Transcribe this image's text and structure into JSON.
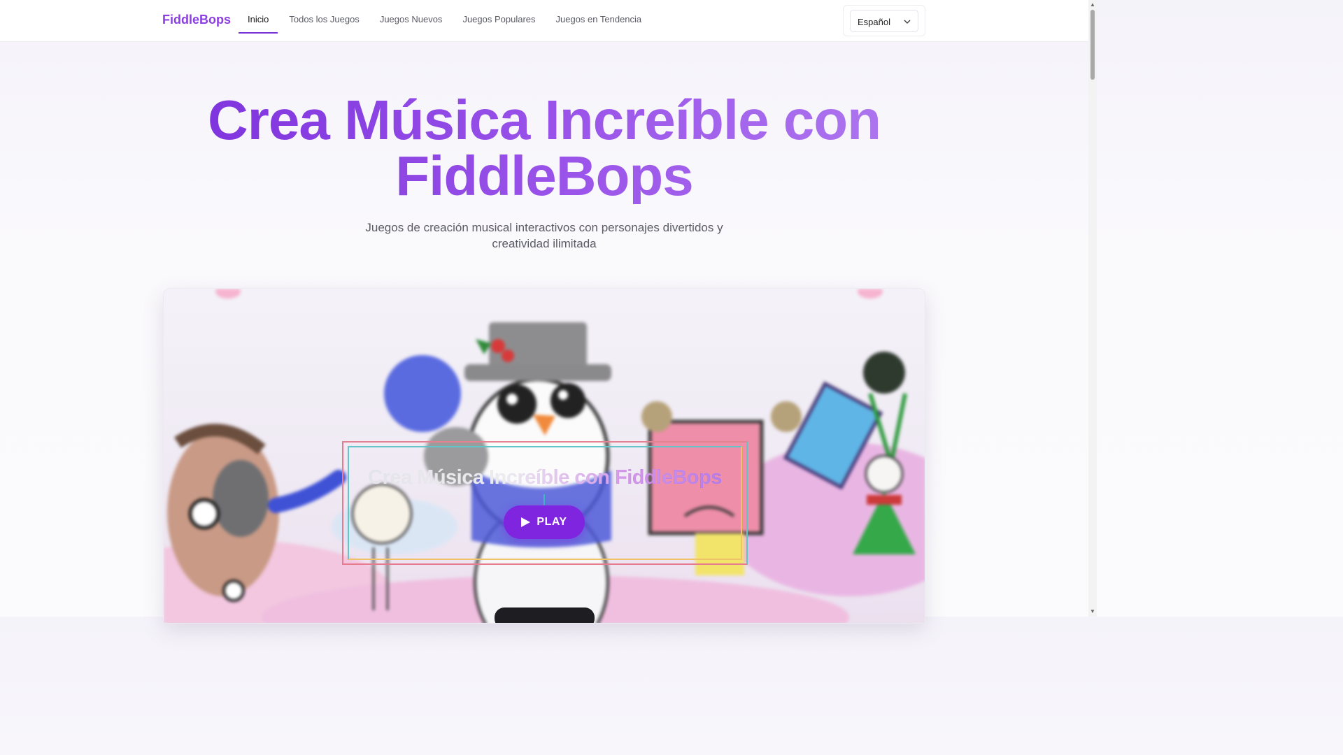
{
  "header": {
    "logo": "FiddleBops",
    "nav": [
      {
        "label": "Inicio",
        "active": true
      },
      {
        "label": "Todos los Juegos",
        "active": false
      },
      {
        "label": "Juegos Nuevos",
        "active": false
      },
      {
        "label": "Juegos Populares",
        "active": false
      },
      {
        "label": "Juegos en Tendencia",
        "active": false
      }
    ],
    "language": "Español"
  },
  "hero": {
    "title_line1": "Crea Música Increíble con",
    "title_line2": "FiddleBops",
    "subtitle_line1": "Juegos de creación musical interactivos con personajes divertidos y",
    "subtitle_line2": "creatividad ilimitada"
  },
  "game": {
    "overlay_title": "Crea Música Increíble con FiddleBops",
    "play_label": "PLAY"
  },
  "colors": {
    "brand": "#8b3fe0",
    "play_button": "#7f25e0",
    "nav_active_underline": "#7a32d8"
  }
}
